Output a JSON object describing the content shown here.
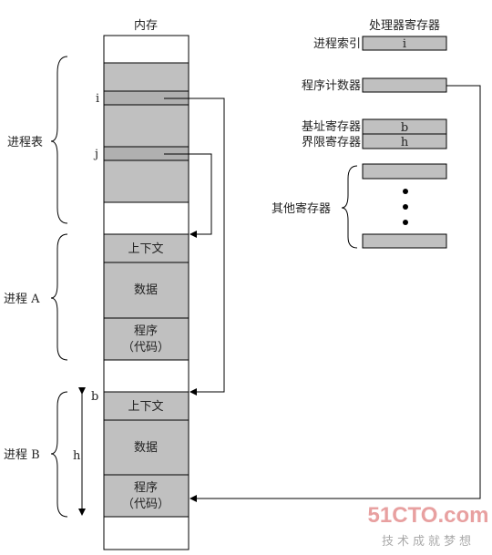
{
  "memory": {
    "title": "内存",
    "context": "上下文",
    "data": "数据",
    "program": "程序",
    "code": "（代码）",
    "i": "i",
    "j": "j",
    "b": "b",
    "h": "h"
  },
  "groups": {
    "process_table": "进程表",
    "process_a": "进程 A",
    "process_b": "进程 B"
  },
  "registers": {
    "title": "处理器寄存器",
    "process_index": "进程索引",
    "process_index_value": "i",
    "pc": "程序计数器",
    "base": "基址寄存器",
    "base_value": "b",
    "limit": "界限寄存器",
    "limit_value": "h",
    "other": "其他寄存器"
  },
  "watermark": {
    "logo": "51CTO.com",
    "slogan": "技术成就梦想"
  },
  "colors": {
    "block": "#c0c0c0",
    "highlight": "#b0b0b0",
    "watermark": "#e8a0a0"
  }
}
